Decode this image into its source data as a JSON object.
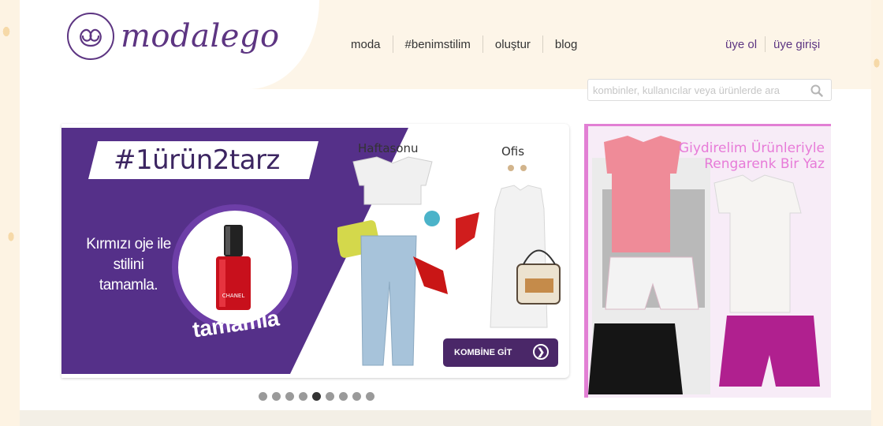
{
  "logo": {
    "text": "modalego"
  },
  "nav": {
    "items": [
      "moda",
      "#benimstilim",
      "oluştur",
      "blog"
    ]
  },
  "auth": {
    "register": "üye ol",
    "login": "üye girişi"
  },
  "search": {
    "placeholder": "kombinler, kullanıcılar veya ürünlerde ara"
  },
  "slider": {
    "hashtag": "#1ürün2tarz",
    "promo_text": "Kırmızı oje ile stilini tamamla.",
    "circle_label": "tamamla",
    "product_brand": "CHANEL",
    "look_1_title": "Haftasonu",
    "look_2_title": "Ofis",
    "button_label": "KOMBİNE GİT",
    "dots_count": 9,
    "active_dot": 5
  },
  "side_ad": {
    "title_line1": "Giydirelim Ürünleriyle",
    "title_line2": "Rengarenk Bir Yaz"
  },
  "colors": {
    "brand_purple": "#5d3582",
    "promo_purple": "#553089",
    "ad_pink": "#e77bd8"
  }
}
